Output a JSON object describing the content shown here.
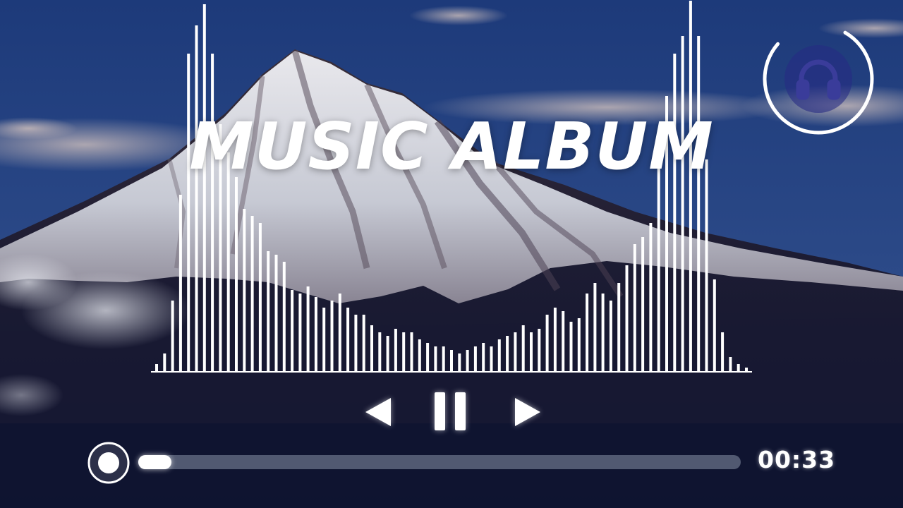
{
  "player": {
    "title": "MUSIC ALBUM",
    "elapsed_time": "00:33",
    "progress": 0.055,
    "state": "playing"
  },
  "loading_ring": {
    "progress": 0.78,
    "icon": "headphones-icon"
  },
  "controls": {
    "previous_icon": "previous-triangle-icon",
    "pause_icon": "pause-icon",
    "next_icon": "next-triangle-icon",
    "seek_handle_icon": "circle-knob-icon"
  },
  "visualizer": {
    "levels": [
      0.02,
      0.05,
      0.2,
      0.5,
      0.9,
      0.98,
      1.04,
      0.9,
      0.7,
      0.62,
      0.55,
      0.46,
      0.44,
      0.42,
      0.34,
      0.33,
      0.31,
      0.23,
      0.22,
      0.24,
      0.21,
      0.18,
      0.2,
      0.22,
      0.18,
      0.16,
      0.16,
      0.13,
      0.11,
      0.1,
      0.12,
      0.11,
      0.11,
      0.09,
      0.08,
      0.07,
      0.07,
      0.06,
      0.05,
      0.06,
      0.07,
      0.08,
      0.07,
      0.09,
      0.1,
      0.11,
      0.13,
      0.11,
      0.12,
      0.16,
      0.18,
      0.17,
      0.14,
      0.15,
      0.22,
      0.25,
      0.22,
      0.2,
      0.25,
      0.3,
      0.36,
      0.38,
      0.42,
      0.6,
      0.78,
      0.9,
      0.95,
      1.05,
      0.95,
      0.6,
      0.26,
      0.11,
      0.04,
      0.02,
      0.01
    ],
    "colors": {
      "bar": "#ffffff",
      "baseline": "#ffffff"
    }
  },
  "colors": {
    "sky_top": "#1d3a7a",
    "sky_bottom": "#3a5a95",
    "mountain_snow": "#e6e6ee",
    "ground_dark": "#121a38",
    "ring": "#ffffff",
    "headphones_icon": "#3a3c9a"
  }
}
